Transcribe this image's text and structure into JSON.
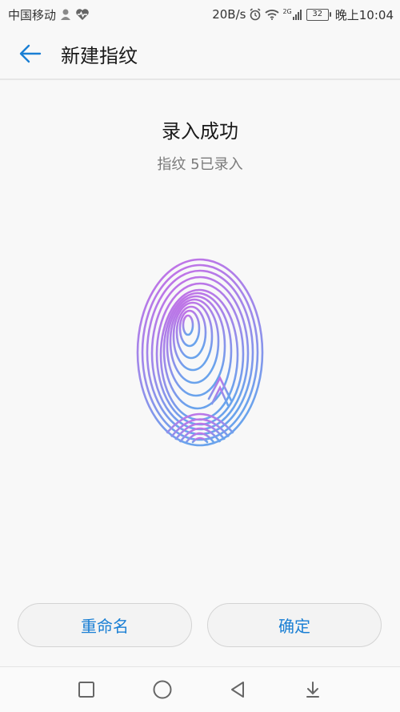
{
  "status_bar": {
    "carrier": "中国移动",
    "network_speed": "20B/s",
    "network_type": "2G",
    "battery": "32",
    "time": "晚上10:04"
  },
  "app_bar": {
    "title": "新建指纹",
    "back_icon": "arrow-left-icon"
  },
  "content": {
    "headline": "录入成功",
    "subline": "指纹 5已录入",
    "fingerprint_icon": "fingerprint-icon"
  },
  "buttons": {
    "rename": "重命名",
    "confirm": "确定"
  },
  "nav_bar": {
    "icons": [
      "recent-apps-icon",
      "home-icon",
      "back-icon",
      "notification-down-icon"
    ]
  },
  "colors": {
    "accent": "#1a7fd4",
    "gradient_top": "#c86ee6",
    "gradient_bottom": "#6aa3ec"
  }
}
